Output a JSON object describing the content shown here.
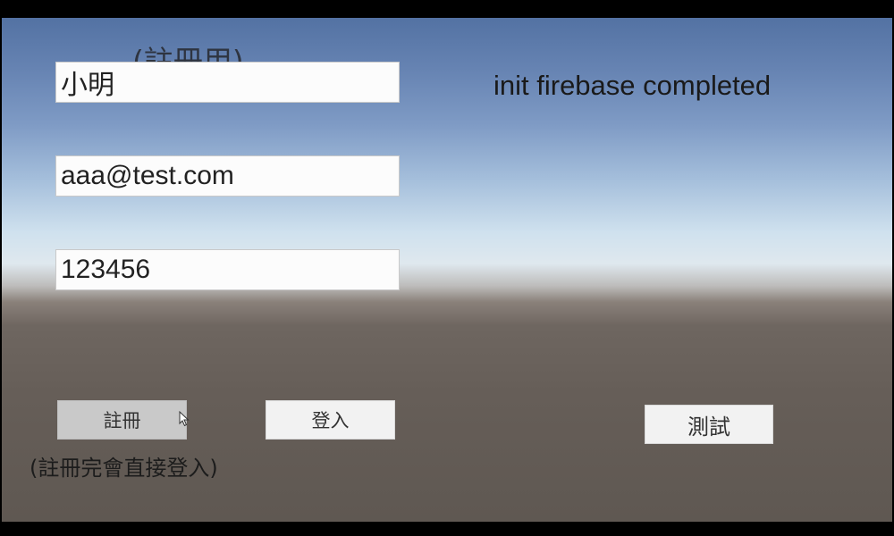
{
  "top_ghost_text": "",
  "register_heading": "(註冊用)",
  "fields": {
    "name": {
      "value": "小明"
    },
    "email": {
      "value": "aaa@test.com"
    },
    "password": {
      "value": "123456"
    }
  },
  "status_text": "init firebase completed",
  "buttons": {
    "register": "註冊",
    "login": "登入",
    "test": "測試"
  },
  "note_text": "(註冊完會直接登入)",
  "colors": {
    "sky_top": "#5372a3",
    "horizon": "#dfe8ee",
    "ground": "#665e58"
  },
  "icons": {
    "cursor": "mouse-pointer-icon"
  }
}
